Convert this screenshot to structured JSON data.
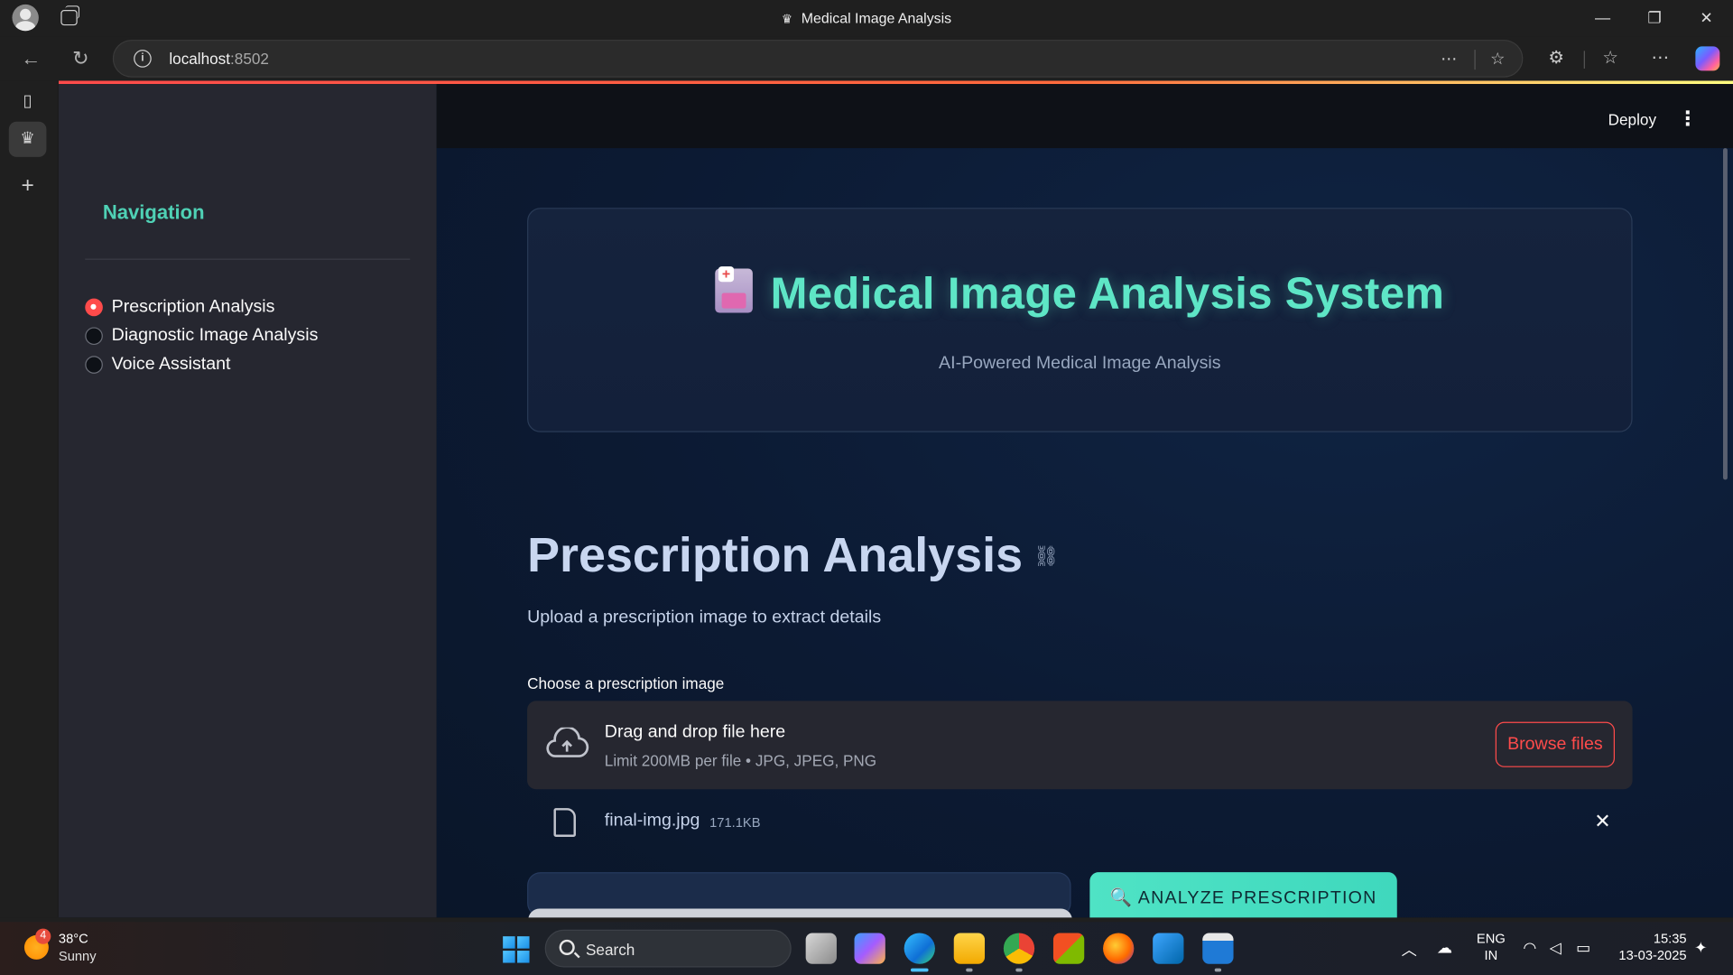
{
  "browser": {
    "window_title": "Medical Image Analysis",
    "url_host": "localhost",
    "url_port": ":8502"
  },
  "app": {
    "header": {
      "deploy_label": "Deploy"
    },
    "sidebar": {
      "title": "Navigation",
      "options": [
        {
          "label": "Prescription Analysis",
          "selected": true
        },
        {
          "label": "Diagnostic Image Analysis",
          "selected": false
        },
        {
          "label": "Voice Assistant",
          "selected": false
        }
      ]
    },
    "hero": {
      "title": "Medical Image Analysis System",
      "subtitle": "AI-Powered Medical Image Analysis"
    },
    "page": {
      "title": "Prescription Analysis",
      "description": "Upload a prescription image to extract details",
      "uploader_label": "Choose a prescription image",
      "dropzone_title": "Drag and drop file here",
      "dropzone_hint": "Limit 200MB per file • JPG, JPEG, PNG",
      "browse_label": "Browse files",
      "file_name": "final-img.jpg",
      "file_size": "171.1KB",
      "analyze_label": "🔍 ANALYZE PRESCRIPTION"
    }
  },
  "taskbar": {
    "weather_badge": "4",
    "weather_temp": "38°C",
    "weather_condition": "Sunny",
    "search_label": "Search",
    "lang_line1": "ENG",
    "lang_line2": "IN",
    "time": "15:35",
    "date": "13-03-2025"
  },
  "colors": {
    "accent_red": "#ff4b4b",
    "accent_teal": "#5ee6c6",
    "sidebar_bg": "#262730"
  }
}
